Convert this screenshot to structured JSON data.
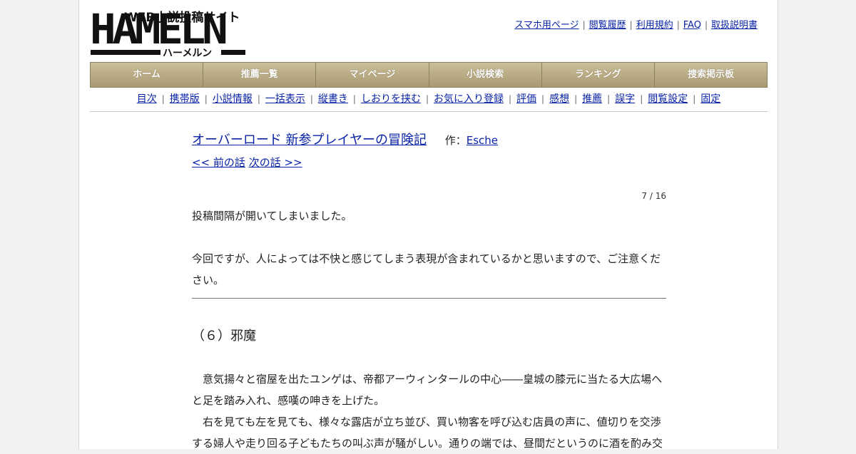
{
  "site": {
    "logo_tagline": "WEB小説投稿サイト",
    "logo_word": "HAMELN",
    "logo_kana": "ハーメルン"
  },
  "toplinks": [
    "スマホ用ページ",
    "閲覧履歴",
    "利用規約",
    "FAQ",
    "取扱説明書"
  ],
  "mainnav": [
    "ホーム",
    "推薦一覧",
    "マイページ",
    "小説検索",
    "ランキング",
    "捜索掲示板"
  ],
  "subnav": [
    "目次",
    "携帯版",
    "小説情報",
    "一括表示",
    "縦書き",
    "しおりを挟む",
    "お気に入り登録",
    "評価",
    "感想",
    "推薦",
    "誤字",
    "閲覧設定",
    "固定"
  ],
  "novel": {
    "title": "オーバーロード 新参プレイヤーの冒険記",
    "author_prefix": "作：",
    "author": "Esche",
    "prev": "<< 前の話",
    "next": "次の話 >>",
    "page_count": "7 / 16",
    "preface": [
      "投稿間隔が開いてしまいました。",
      "",
      "今回ですが、人によっては不快と感じてしまう表現が含まれているかと思いますので、ご注意ください。"
    ],
    "chapter_title": "（６）邪魔",
    "body": [
      "　意気揚々と宿屋を出たユンゲは、帝都アーウィンタールの中心――皇城の膝元に当たる大広場へと足を踏み入れ、感嘆の呻きを上げた。",
      "　右を見ても左を見ても、様々な露店が立ち並び、買い物客を呼び込む店員の声に、値切りを交渉する婦人や走り回る子どもたちの叫ぶ声が騒がしい。通りの端では、昼間だというのに酒を酌み交"
    ]
  }
}
